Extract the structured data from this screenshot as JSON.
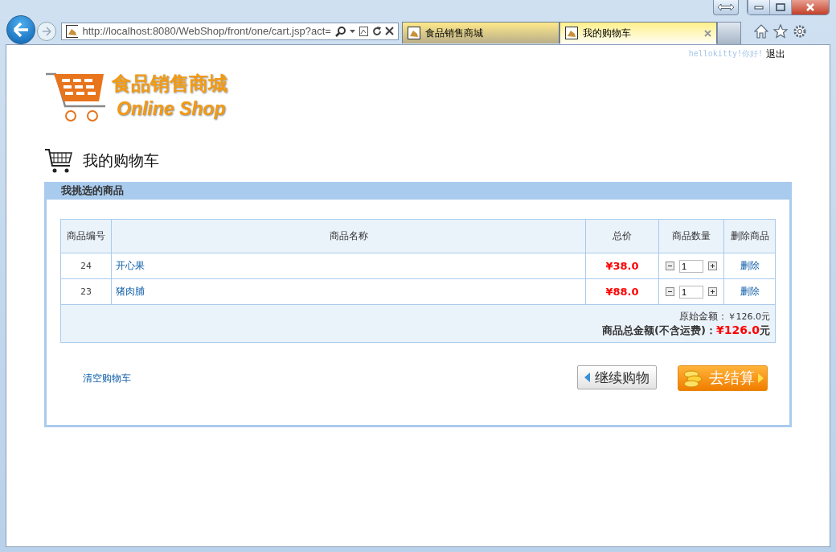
{
  "browser": {
    "url": "http://localhost:8080/WebShop/front/one/cart.jsp?act=",
    "tabs": [
      {
        "title": "食品销售商城",
        "selected": false
      },
      {
        "title": "我的购物车",
        "selected": true
      }
    ]
  },
  "header": {
    "greeting": "hellokitty!你好!",
    "logout": "退出",
    "logo_title": "食品销售商城",
    "logo_subtitle": "Online Shop"
  },
  "page_title": "我的购物车",
  "panel": {
    "title": "我挑选的商品",
    "table": {
      "columns": [
        "商品编号",
        "商品名称",
        "总价",
        "商品数量",
        "删除商品"
      ],
      "rows": [
        {
          "id": "24",
          "name": "开心果",
          "total": "¥38.0",
          "quantity": "1",
          "action": "删除"
        },
        {
          "id": "23",
          "name": "猪肉脯",
          "total": "¥88.0",
          "quantity": "1",
          "action": "删除"
        }
      ],
      "summary": {
        "original_label": "原始金额：",
        "original_value": "￥126.0元",
        "total_label": "商品总金额(不含运费)：",
        "total_value": "¥126.0",
        "total_unit": "元"
      }
    },
    "clear_cart": "清空购物车",
    "continue_button": "继续购物",
    "checkout_button": "去结算"
  }
}
